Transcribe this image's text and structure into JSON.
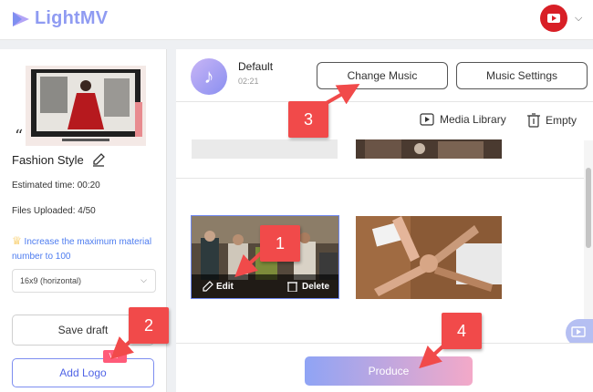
{
  "app": {
    "name": "LightMV"
  },
  "header": {
    "avatar_icon": "youtube-avatar-icon"
  },
  "sidebar": {
    "style_name": "Fashion Style",
    "estimated_time": "Estimated time: 00:20",
    "files_uploaded": "Files Uploaded: 4/50",
    "upgrade_text": "Increase the maximum material number to 100",
    "aspect_ratio": "16x9 (horizontal)",
    "save_label": "Save draft",
    "add_logo_label": "Add Logo",
    "vip_badge": "VIP"
  },
  "music": {
    "title": "Default",
    "duration": "02:21",
    "change_label": "Change Music",
    "settings_label": "Music Settings"
  },
  "toolbar": {
    "media_library": "Media Library",
    "empty": "Empty"
  },
  "clip": {
    "edit_label": "Edit",
    "delete_label": "Delete"
  },
  "produce_label": "Produce",
  "callouts": [
    "1",
    "2",
    "3",
    "4"
  ],
  "colors": {
    "accent": "#5064e6",
    "callout": "#f14a4a",
    "logo": "#8f9bf2"
  }
}
